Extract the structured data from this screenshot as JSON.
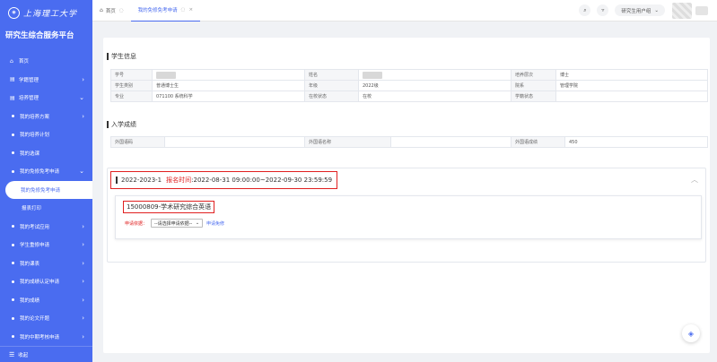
{
  "sidebar": {
    "logo_text": "上海理工大学",
    "platform_title": "研究生综合服务平台",
    "items": [
      {
        "label": "首页",
        "icon": "home-icon"
      },
      {
        "label": "学籍管理",
        "icon": "folder-icon"
      },
      {
        "label": "培养管理",
        "icon": "folder-icon"
      },
      {
        "label": "我的培养方案"
      },
      {
        "label": "我的培养计划"
      },
      {
        "label": "我的选课"
      },
      {
        "label": "我的免修免考申请"
      },
      {
        "label": "我的免修免考申请"
      },
      {
        "label": "报表打印"
      },
      {
        "label": "我的考试应用"
      },
      {
        "label": "学生重修申请"
      },
      {
        "label": "我的课表"
      },
      {
        "label": "我的成绩认定申请"
      },
      {
        "label": "我的成绩"
      },
      {
        "label": "我的论文开题"
      },
      {
        "label": "我的中期考核申请"
      }
    ],
    "collapse_label": "收起"
  },
  "topbar": {
    "tabs": [
      {
        "label": "首页"
      },
      {
        "label": "我的免修免考申请"
      }
    ],
    "role_label": "研究生用户组"
  },
  "student_info": {
    "title": "学生信息",
    "rows": [
      [
        {
          "label": "学号",
          "value": ""
        },
        {
          "label": "姓名",
          "value": ""
        },
        {
          "label": "培养层次",
          "value": "博士"
        }
      ],
      [
        {
          "label": "学生类别",
          "value": "普通博士生"
        },
        {
          "label": "年级",
          "value": "2022级"
        },
        {
          "label": "院系",
          "value": "管理学院"
        }
      ],
      [
        {
          "label": "专业",
          "value": "071100 系统科学"
        },
        {
          "label": "在校状态",
          "value": "在校"
        },
        {
          "label": "学籍状态",
          "value": ""
        }
      ]
    ]
  },
  "entrance_scores": {
    "title": "入学成绩",
    "rows": [
      [
        {
          "label": "外国语码",
          "value": ""
        },
        {
          "label": "外国语名称",
          "value": ""
        },
        {
          "label": "外国语成绩",
          "value": "450"
        }
      ]
    ]
  },
  "application": {
    "term": "2022-2023-1",
    "period_label": "报名时间",
    "period_value": ":2022-08-31 09:00:00~2022-09-30 23:59:59",
    "course": "15000809-学术研究综合英语",
    "basis_label": "申请依据：",
    "basis_placeholder": "--请选择申请依据--",
    "apply_link": "申请免修"
  }
}
